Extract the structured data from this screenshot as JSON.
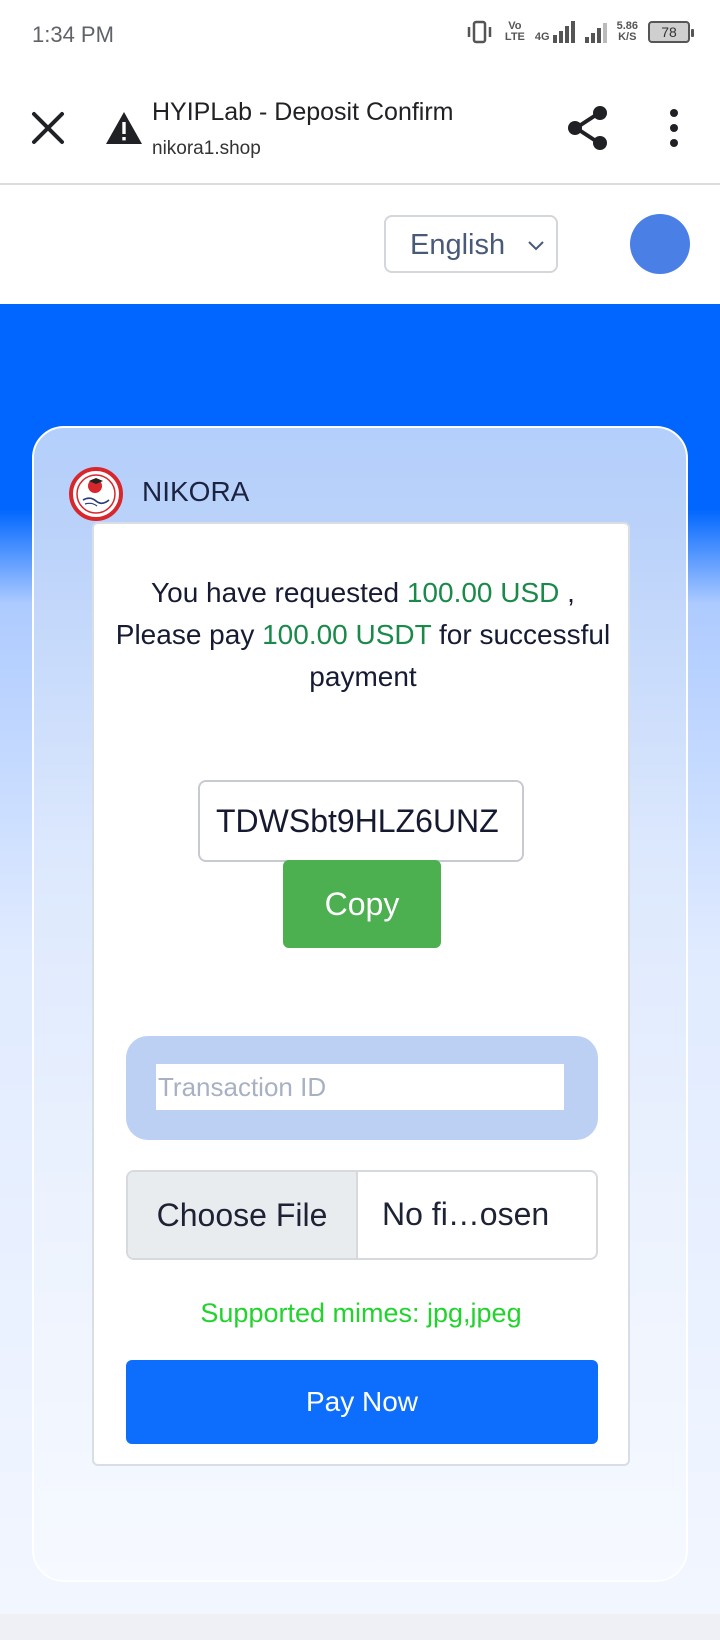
{
  "status_bar": {
    "time": "1:34 PM",
    "volte_top": "Vo",
    "volte_bottom": "LTE",
    "network": "4G",
    "speed_value": "5.86",
    "speed_unit": "K/S",
    "battery": "78"
  },
  "browser": {
    "title": "HYIPLab - Deposit Confirm",
    "url": "nikora1.shop"
  },
  "language": {
    "selected": "English"
  },
  "brand": {
    "name": "NIKORA"
  },
  "deposit": {
    "msg_part1": "You have requested ",
    "requested_amount": "100.00 USD",
    "msg_part2": " , Please pay ",
    "pay_amount": "100.00 USDT",
    "msg_part3": " for successful payment",
    "wallet_address": "TDWSbt9HLZ6UNZ",
    "copy_label": "Copy",
    "transaction_placeholder": "Transaction ID",
    "choose_file_label": "Choose File",
    "file_name": "No fi…osen",
    "supported_mimes": "Supported mimes: jpg,jpeg",
    "pay_now_label": "Pay Now"
  },
  "colors": {
    "header_blue": "#0066ff",
    "amount_green": "#1a8a4a",
    "copy_green": "#4caf50",
    "mimes_green": "#22d32e",
    "pay_blue": "#0d6efd",
    "avatar_blue": "#4a7fe6"
  },
  "icons": {
    "close": "close-icon",
    "warning": "warning-icon",
    "share": "share-icon",
    "more": "more-vert-icon",
    "chevron": "chevron-down-icon",
    "logo": "nikora-logo"
  }
}
